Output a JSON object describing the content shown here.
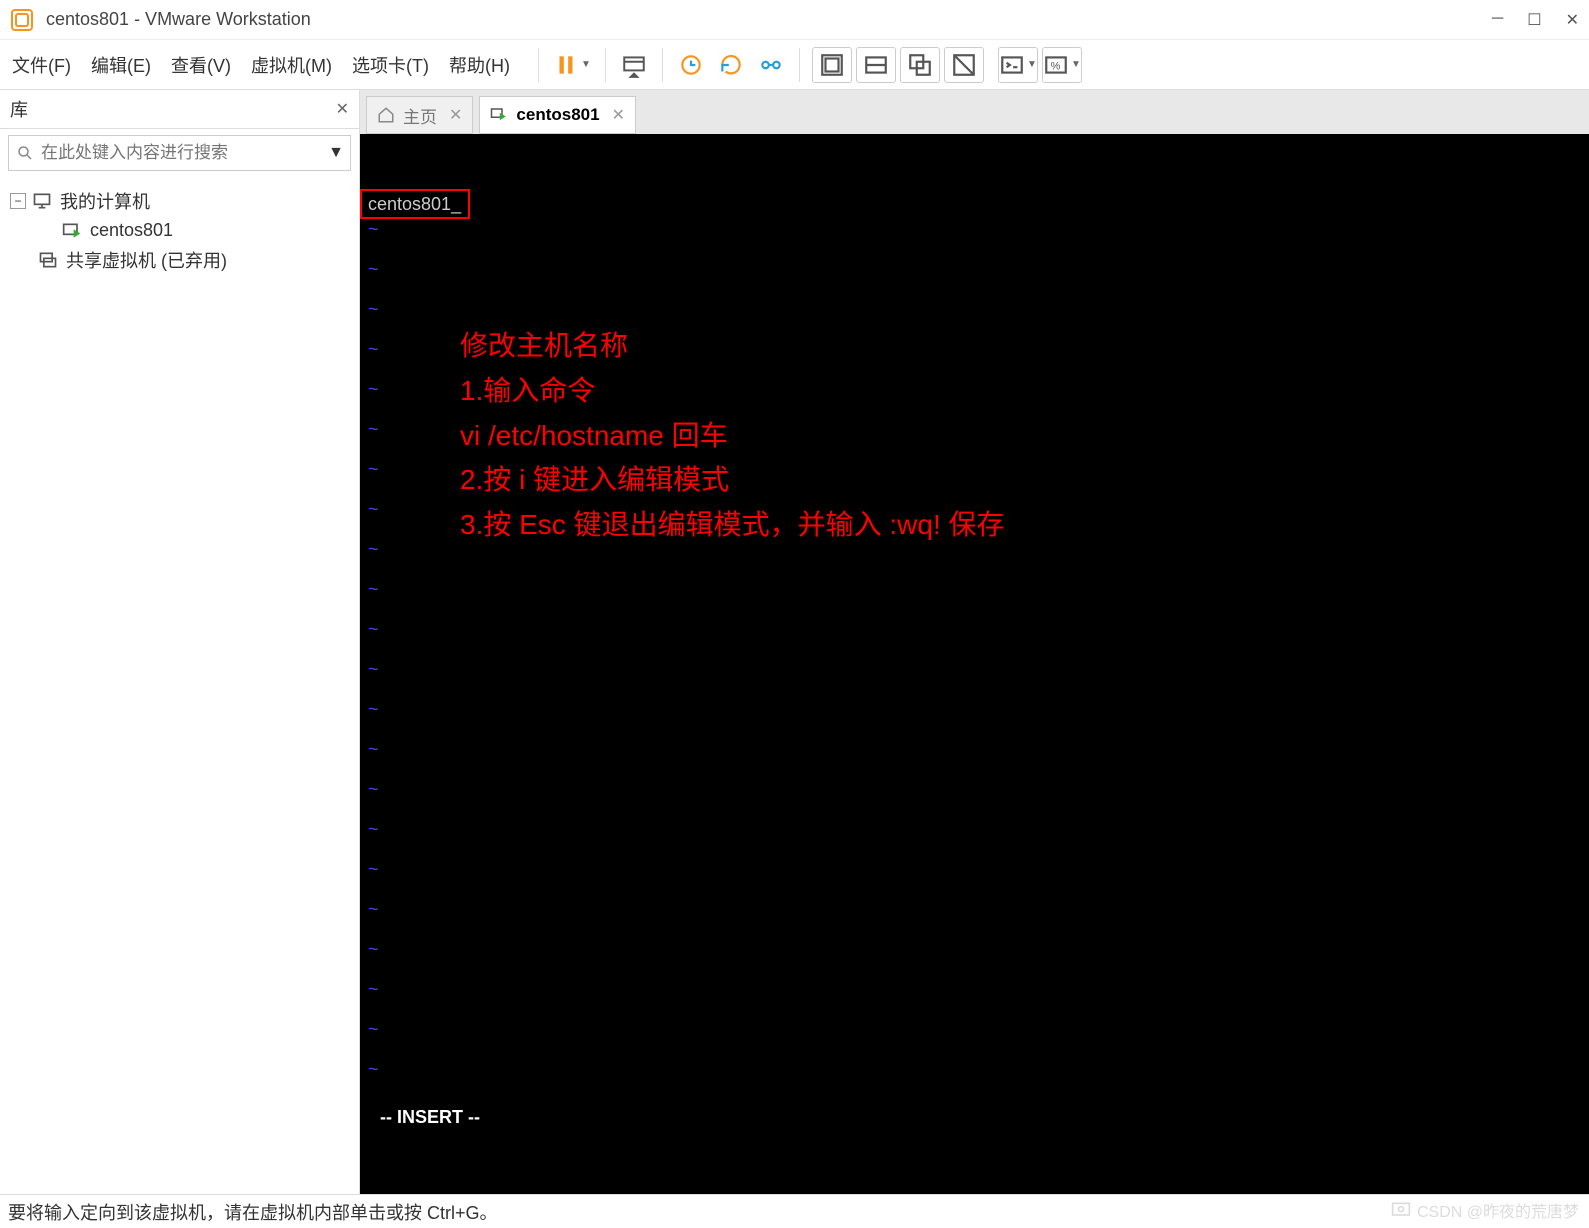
{
  "window": {
    "title": "centos801 - VMware Workstation"
  },
  "menu": {
    "file": "文件(F)",
    "edit": "编辑(E)",
    "view": "查看(V)",
    "vm": "虚拟机(M)",
    "tabs": "选项卡(T)",
    "help": "帮助(H)"
  },
  "sidebar": {
    "title": "库",
    "search_placeholder": "在此处键入内容进行搜索",
    "tree": {
      "root": "我的计算机",
      "vm": "centos801",
      "shared": "共享虚拟机 (已弃用)"
    }
  },
  "tabs": {
    "home": "主页",
    "active": "centos801"
  },
  "terminal": {
    "hostname": "centos801_",
    "mode": "-- INSERT --"
  },
  "annotation": {
    "l1": "修改主机名称",
    "l2": "1.输入命令",
    "l3": "vi /etc/hostname 回车",
    "l4": "2.按 i 键进入编辑模式",
    "l5": "3.按 Esc 键退出编辑模式，并输入 :wq! 保存"
  },
  "statusbar": {
    "text": "要将输入定向到该虚拟机，请在虚拟机内部单击或按 Ctrl+G。"
  },
  "watermark": {
    "text": "CSDN @昨夜的荒唐梦"
  }
}
